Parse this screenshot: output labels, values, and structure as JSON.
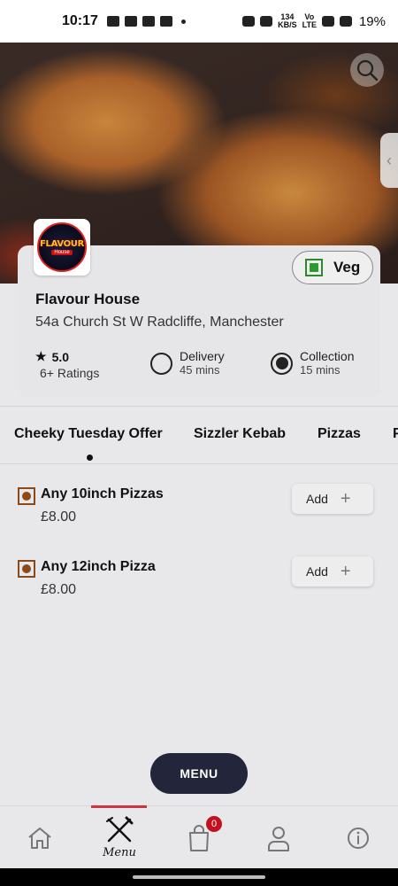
{
  "status_bar": {
    "time": "10:17",
    "net_speed": "134\nKB/S",
    "volte": "Vo\nLTE",
    "signal": "4G",
    "battery": "19%"
  },
  "hero": {
    "search_icon": "search-icon",
    "side_tab_icon": "chevron-left-icon"
  },
  "restaurant": {
    "logo_text": "FLAVOUR",
    "logo_sub": "House",
    "name": "Flavour House",
    "address": "54a Church St W Radcliffe, Manchester",
    "rating": "5.0",
    "rating_count": "6+ Ratings",
    "veg_label": "Veg",
    "delivery": {
      "title": "Delivery",
      "time": "45 mins",
      "selected": false
    },
    "collection": {
      "title": "Collection",
      "time": "15 mins",
      "selected": true
    }
  },
  "categories": [
    {
      "label": "Cheeky Tuesday Offer",
      "active": true
    },
    {
      "label": "Sizzler Kebab",
      "active": false
    },
    {
      "label": "Pizzas",
      "active": false
    },
    {
      "label": "P",
      "active": false
    }
  ],
  "items": [
    {
      "name": "Any 10inch Pizzas",
      "price": "£8.00",
      "add_label": "Add"
    },
    {
      "name": "Any 12inch Pizza",
      "price": "£8.00",
      "add_label": "Add"
    }
  ],
  "menu_fab_label": "MENU",
  "bottom_nav": {
    "menu_label": "Menu",
    "cart_count": "0"
  },
  "colors": {
    "accent": "#d0353d",
    "fab": "#23253a",
    "veg": "#2c9a2c",
    "nonveg": "#8a4a1a",
    "badge": "#c1121f"
  }
}
